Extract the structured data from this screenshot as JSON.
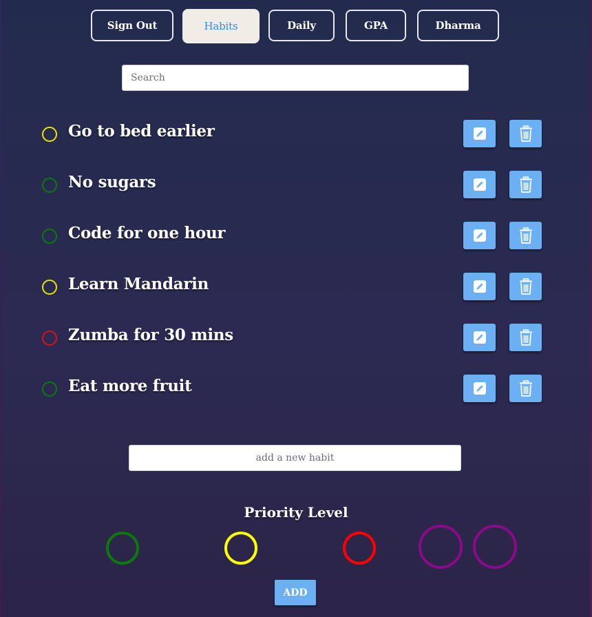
{
  "nav": {
    "sign_out": "Sign Out",
    "habits": "Habits",
    "daily": "Daily",
    "gpa": "GPA",
    "dharma": "Dharma",
    "active_tab": "Habits"
  },
  "search": {
    "placeholder": "Search",
    "value": ""
  },
  "habits": [
    {
      "label": "Go to bed earlier",
      "priority_color": "#e6e600"
    },
    {
      "label": "No sugars",
      "priority_color": "#0a7a0a"
    },
    {
      "label": "Code for one hour",
      "priority_color": "#0a7a0a"
    },
    {
      "label": "Learn Mandarin",
      "priority_color": "#e6e600"
    },
    {
      "label": "Zumba for 30 mins",
      "priority_color": "#e01010"
    },
    {
      "label": "Eat more fruit",
      "priority_color": "#0a7a0a"
    }
  ],
  "row_actions": {
    "edit_icon": "pencil-square-icon",
    "delete_icon": "trash-icon"
  },
  "new_habit": {
    "placeholder": "add a new habit",
    "value": ""
  },
  "priority": {
    "title": "Priority Level",
    "options": [
      {
        "name": "green",
        "color": "#0a7a0a"
      },
      {
        "name": "yellow",
        "color": "#ffff00"
      },
      {
        "name": "red",
        "color": "#ff0000"
      },
      {
        "name": "purple",
        "color": "#8a0a8a"
      },
      {
        "name": "purple",
        "color": "#8a0a8a"
      }
    ]
  },
  "add_button": "ADD",
  "colors": {
    "accent_button": "#6cb0f4",
    "active_tab_bg": "#f1ede6",
    "active_tab_text": "#2d8cf0",
    "background": "#262a50"
  }
}
